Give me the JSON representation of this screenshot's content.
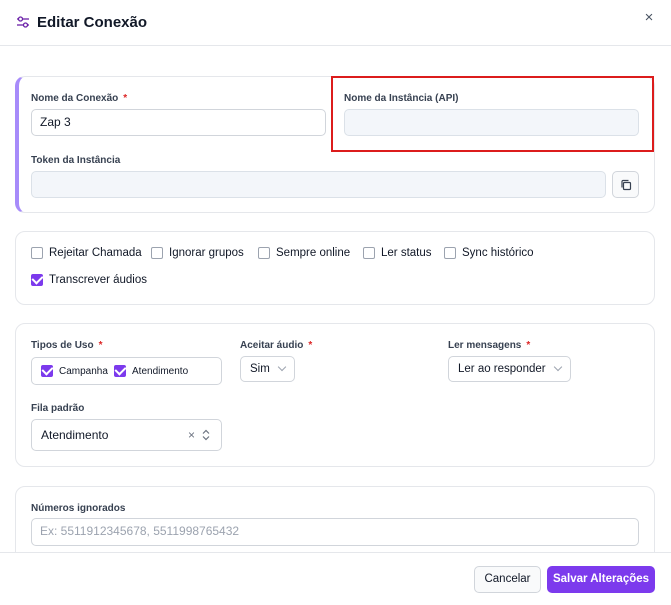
{
  "dialog": {
    "title": "Editar Conexão",
    "close_label": "×"
  },
  "connection": {
    "name_label": "Nome da Conexão",
    "name_required": "*",
    "name_value": "Zap 3",
    "instance_label": "Nome da Instância (API)",
    "instance_value": "",
    "token_label": "Token da Instância",
    "token_value": ""
  },
  "options": [
    {
      "label": "Rejeitar Chamada",
      "checked": false
    },
    {
      "label": "Ignorar grupos",
      "checked": false
    },
    {
      "label": "Sempre online",
      "checked": false
    },
    {
      "label": "Ler status",
      "checked": false
    },
    {
      "label": "Sync histórico",
      "checked": false
    },
    {
      "label": "Transcrever áudios",
      "checked": true
    }
  ],
  "usage": {
    "types_label": "Tipos de Uso",
    "types_required": "*",
    "types": [
      {
        "label": "Campanha",
        "checked": true
      },
      {
        "label": "Atendimento",
        "checked": true
      }
    ],
    "audio_label": "Aceitar áudio",
    "audio_required": "*",
    "audio_value": "Sim",
    "read_label": "Ler mensagens",
    "read_required": "*",
    "read_value": "Ler ao responder",
    "queue_label": "Fila padrão",
    "queue_value": "Atendimento",
    "queue_clear": "×"
  },
  "ignored": {
    "label": "Números ignorados",
    "placeholder": "Ex: 5511912345678, 5511998765432"
  },
  "footer": {
    "cancel_label": "Cancelar",
    "save_label": "Salvar Alterações"
  },
  "colors": {
    "accent": "#7c3aed",
    "highlight": "#dc1c1c",
    "required": "#dc2626"
  }
}
